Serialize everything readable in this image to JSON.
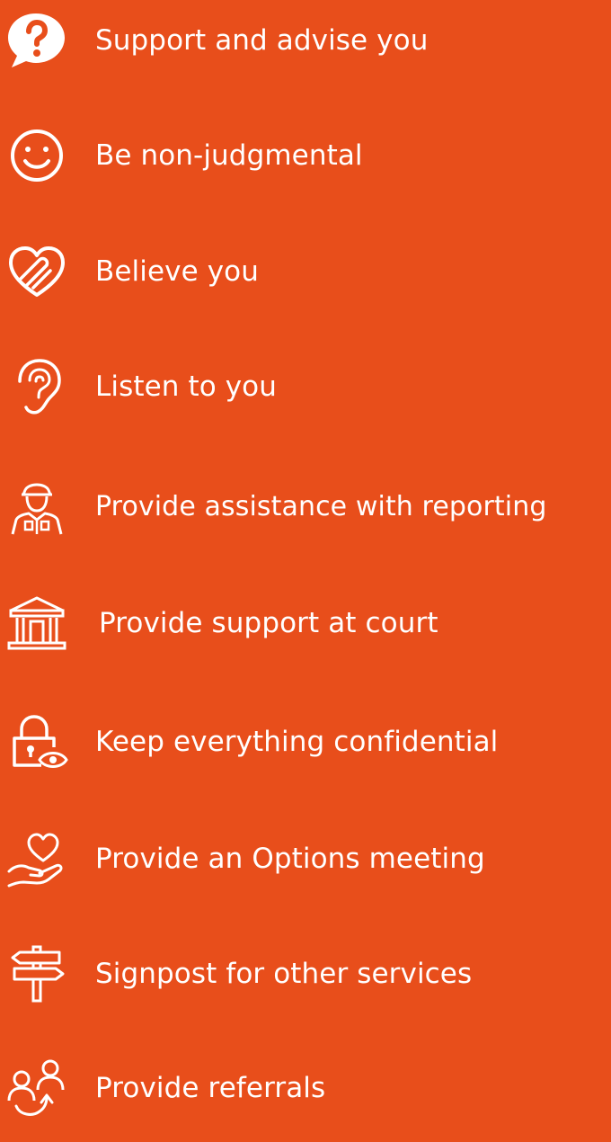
{
  "colors": {
    "background": "#E84E1B",
    "foreground": "#FFFFFF"
  },
  "services": [
    {
      "label": "Support and advise you",
      "icon": "speech-bubble-question-icon"
    },
    {
      "label": "Be non-judgmental",
      "icon": "smiley-face-icon"
    },
    {
      "label": "Believe you",
      "icon": "hand-on-heart-icon"
    },
    {
      "label": "Listen to you",
      "icon": "ear-icon"
    },
    {
      "label": "Provide assistance with reporting",
      "icon": "police-officer-icon"
    },
    {
      "label": "Provide support at court",
      "icon": "courthouse-icon"
    },
    {
      "label": "Keep everything confidential",
      "icon": "padlock-eye-icon"
    },
    {
      "label": "Provide an Options meeting",
      "icon": "heart-in-hand-icon"
    },
    {
      "label": "Signpost for other services",
      "icon": "signpost-icon"
    },
    {
      "label": "Provide referrals",
      "icon": "people-referral-icon"
    }
  ]
}
